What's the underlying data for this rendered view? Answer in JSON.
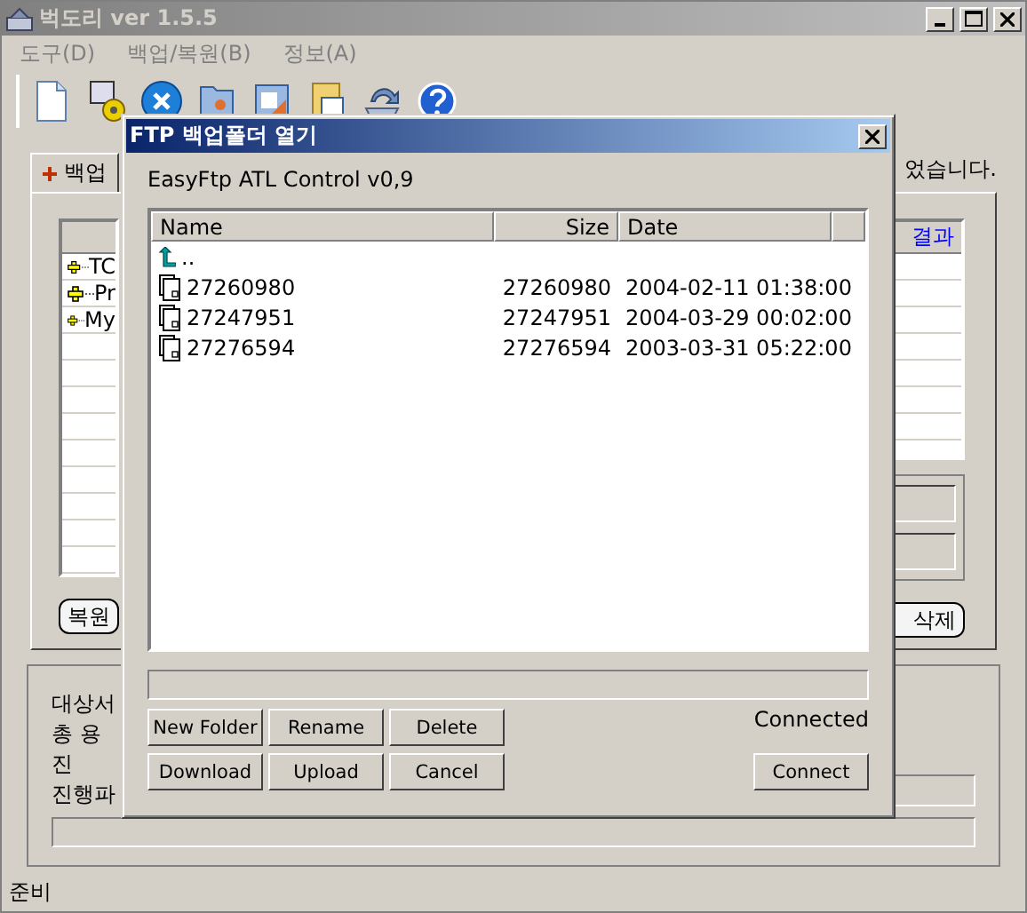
{
  "window": {
    "title": "벅도리 ver 1.5.5"
  },
  "menu": [
    "도구(D)",
    "백업/복원(B)",
    "정보(A)"
  ],
  "tabs": [
    {
      "label": "백업",
      "selected": true
    }
  ],
  "notice": "었습니다.",
  "tree": [
    {
      "label": "TC",
      "expanded": false
    },
    {
      "label": "Pr",
      "expanded": false
    },
    {
      "label": "My",
      "expanded": false
    }
  ],
  "result_column": "결과",
  "buttons_left": "복원",
  "buttons_right": "삭제",
  "info_labels": [
    "대상서",
    "총 용",
    "진",
    "진행파"
  ],
  "info_progress": {
    "level": 0
  },
  "status_bar": "준비",
  "dialog": {
    "title": "FTP 백업폴더 열기",
    "version": "EasyFtp ATL Control v0,9",
    "columns": [
      "Name",
      "Size",
      "Date"
    ],
    "files": [
      {
        "kind": "parent",
        "name": ".."
      },
      {
        "kind": "file",
        "name": "27260980",
        "size": "27260980",
        "date": "2004-02-11 01:38:00"
      },
      {
        "kind": "file",
        "name": "27247951",
        "size": "27247951",
        "date": "2004-03-29 00:02:00"
      },
      {
        "kind": "file",
        "name": "27276594",
        "size": "27276594",
        "date": "2003-03-31 05:22:00"
      }
    ],
    "progress": {
      "level": 0
    },
    "connection": "Connected",
    "button_rows": [
      [
        "New Folder",
        "Rename",
        "Delete"
      ],
      [
        "Download",
        "Upload",
        "Cancel"
      ]
    ],
    "connect_button": "Connect"
  }
}
